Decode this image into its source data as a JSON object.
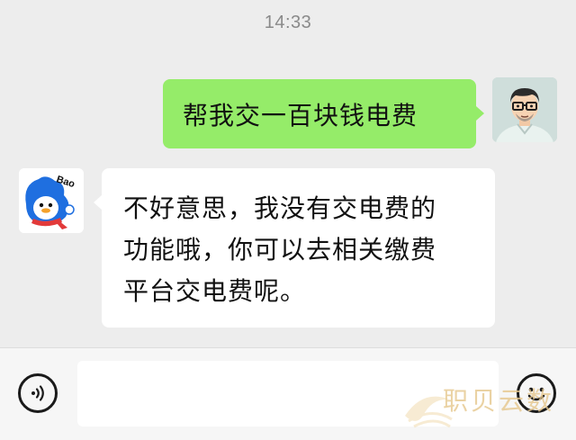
{
  "header": {
    "timestamp": "14:33"
  },
  "messages": [
    {
      "sender": "user",
      "avatar_icon": "man-with-glasses-avatar-icon",
      "text": "帮我交一百块钱电费"
    },
    {
      "sender": "bot",
      "avatar_icon": "bao-duck-avatar-icon",
      "avatar_label": "Bao",
      "lines": [
        "不好意思，我没有交电费的",
        "功能哦，你可以去相关缴费",
        "平台交电费呢。"
      ]
    }
  ],
  "input_bar": {
    "voice_icon": "voice-icon",
    "text_value": "",
    "emoji_icon": "emoji-smile-icon"
  },
  "watermark": {
    "text": "职贝云数"
  },
  "colors": {
    "background": "#ededed",
    "outgoing_bubble": "#95ec69",
    "incoming_bubble": "#ffffff",
    "timestamp": "#8a8a8a"
  }
}
